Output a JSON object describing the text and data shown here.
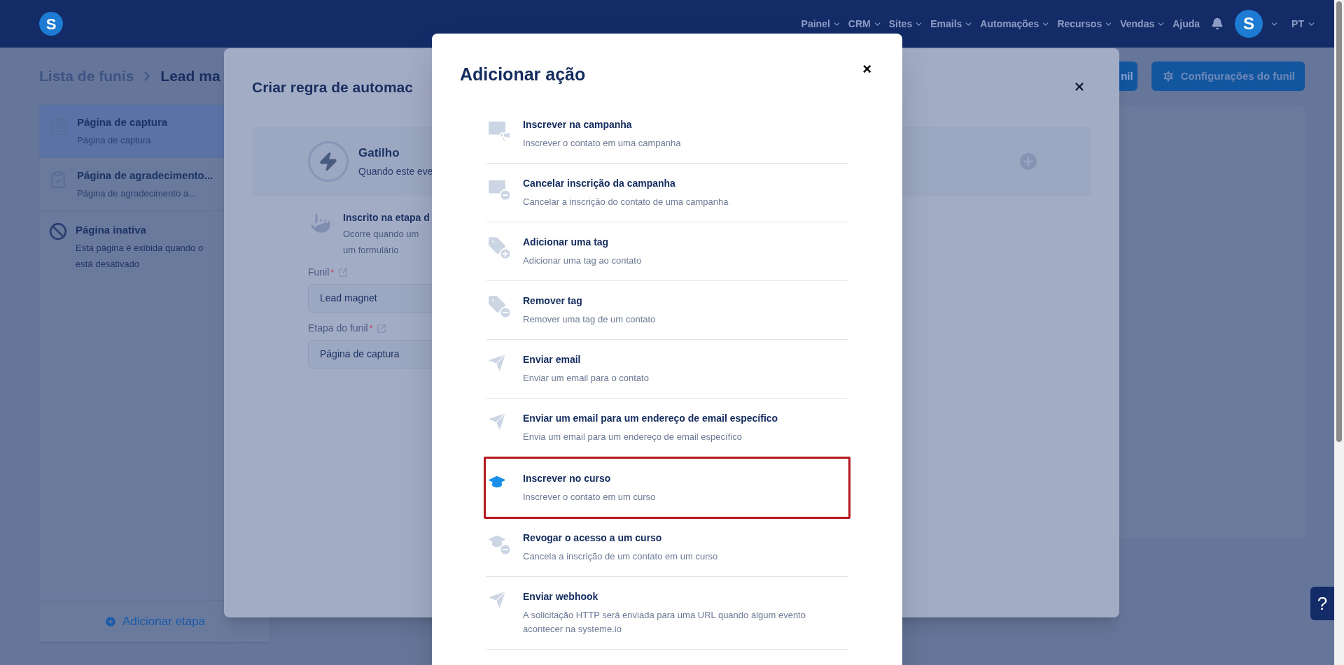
{
  "nav": {
    "logo": "S",
    "items": [
      {
        "label": "Painel"
      },
      {
        "label": "CRM"
      },
      {
        "label": "Sites"
      },
      {
        "label": "Emails"
      },
      {
        "label": "Automações"
      },
      {
        "label": "Recursos"
      },
      {
        "label": "Vendas"
      }
    ],
    "help": "Ajuda",
    "avatar": "S",
    "language": "PT"
  },
  "breadcrumb": {
    "parent": "Lista de funis",
    "current": "Lead ma"
  },
  "header_buttons": [
    {
      "label": "nil"
    },
    {
      "label": "Configurações do funil"
    }
  ],
  "steps": [
    {
      "title": "Página de captura",
      "subtitle": "Página de captura",
      "selected": true
    },
    {
      "title": "Página de agradecimento...",
      "subtitle": "Página de agradecimento a...",
      "selected": false
    }
  ],
  "inactive_step": {
    "title": "Página inativa",
    "lines": [
      "Esta página é exibida quando o",
      "está desativado"
    ]
  },
  "add_step": "Adicionar etapa",
  "rule_dialog": {
    "title": "Criar regra de automac",
    "trigger_title": "Gatilho",
    "trigger_text": "Quando este eve",
    "event_title": "Inscrito na etapa d",
    "event_lines": [
      "Ocorre quando um",
      "um formulário"
    ],
    "fields": [
      {
        "label": "Funil",
        "required_mark": "*",
        "value": "Lead magnet"
      },
      {
        "label": "Etapa do funil",
        "required_mark": "*",
        "value": "Página de captura"
      }
    ]
  },
  "action_dialog": {
    "title": "Adicionar ação",
    "close": "×",
    "actions": [
      {
        "title": "Inscrever na campanha",
        "description": "Inscrever o contato em uma campanha",
        "highlighted": false
      },
      {
        "title": "Cancelar inscrição da campanha",
        "description": "Cancelar a inscrição do contato de uma campanha",
        "highlighted": false
      },
      {
        "title": "Adicionar uma tag",
        "description": "Adicionar uma tag ao contato",
        "highlighted": false
      },
      {
        "title": "Remover tag",
        "description": "Remover uma tag de um contato",
        "highlighted": false
      },
      {
        "title": "Enviar email",
        "description": "Enviar um email para o contato",
        "highlighted": false
      },
      {
        "title": "Enviar um email para um endereço de email específico",
        "description": "Envia um email para um endereço de email específico",
        "highlighted": false
      },
      {
        "title": "Inscrever no curso",
        "description": "Inscrever o contato em um curso",
        "highlighted": true
      },
      {
        "title": "Revogar o acesso a um curso",
        "description": "Cancela a inscrição de um contato em um curso",
        "highlighted": false
      },
      {
        "title": "Enviar webhook",
        "description": "A solicitação HTTP será enviada para uma URL quando algum evento acontecer na systeme.io",
        "highlighted": false
      }
    ]
  },
  "help_button": "?"
}
